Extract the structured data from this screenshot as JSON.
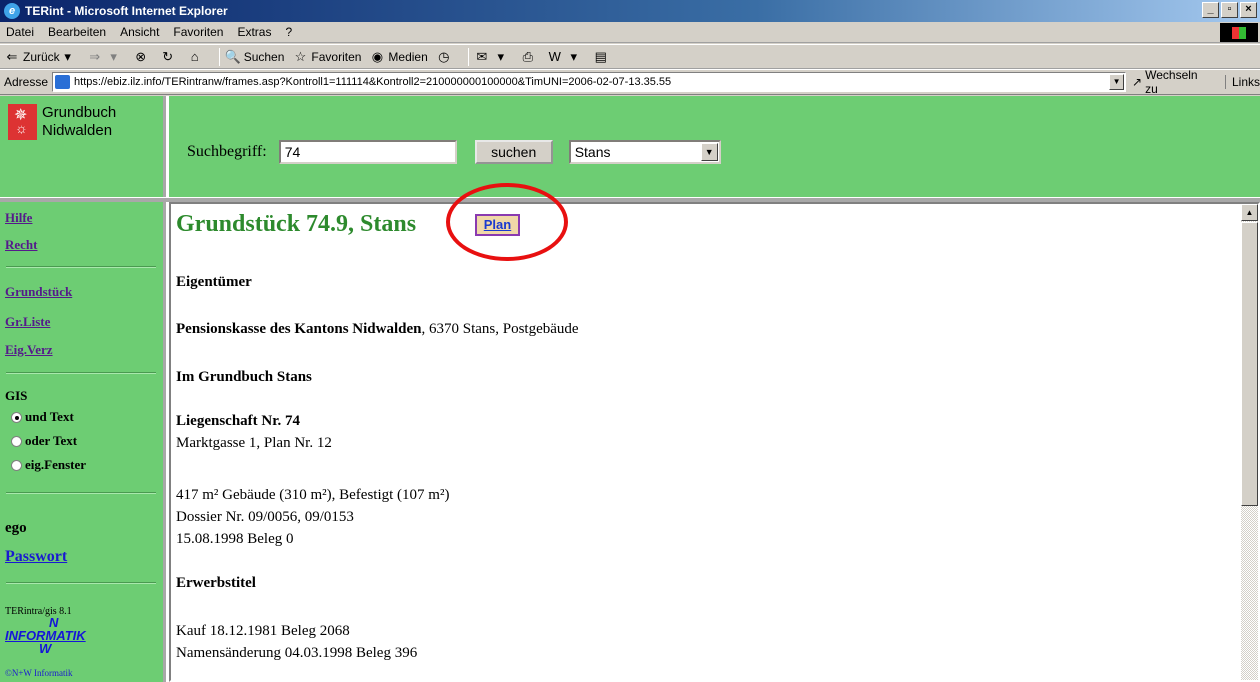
{
  "window": {
    "title": "TERint - Microsoft Internet Explorer",
    "minimize": "_",
    "maximize": "▫",
    "close": "×"
  },
  "menu": [
    "Datei",
    "Bearbeiten",
    "Ansicht",
    "Favoriten",
    "Extras",
    "?"
  ],
  "toolbar": {
    "back": "Zurück",
    "search": "Suchen",
    "favorites": "Favoriten",
    "media": "Medien"
  },
  "address": {
    "label": "Adresse",
    "url": "https://ebiz.ilz.info/TERintranw/frames.asp?Kontroll1=111114&Kontroll2=210000000100000&TimUNI=2006-02-07-13.35.55",
    "go": "Wechseln zu",
    "links": "Links"
  },
  "logo": {
    "line1": "Grundbuch",
    "line2": "Nidwalden"
  },
  "search": {
    "label": "Suchbegriff:",
    "value": "74",
    "button": "suchen",
    "municipality": "Stans"
  },
  "nav": {
    "help": "Hilfe",
    "law": "Recht",
    "parcel": "Grundstück",
    "parcel_list": "Gr.Liste",
    "owner_list": "Eig.Verz",
    "gis_label": "GIS",
    "gis_options": [
      {
        "label": "und Text",
        "checked": true
      },
      {
        "label": "oder Text",
        "checked": false
      },
      {
        "label": "eig.Fenster",
        "checked": false
      }
    ],
    "user": "ego",
    "password": "Passwort",
    "version": "TERintra/gis 8.1",
    "company_n": "N",
    "company": "INFORMATIK",
    "company_w": "W",
    "copyright": "©N+W Informatik"
  },
  "main": {
    "title": "Grundstück 74.9, Stans",
    "plan_button": "Plan",
    "owner_heading": "Eigentümer",
    "owner_name": "Pensionskasse des Kantons Nidwalden",
    "owner_address": ", 6370 Stans, Postgebäude",
    "registry_heading": "Im Grundbuch Stans",
    "property_heading": "Liegenschaft Nr. 74",
    "property_location": "Marktgasse 1, Plan Nr. 12",
    "area_line": "417 m² Gebäude (310 m²), Befestigt (107 m²)",
    "dossier_line": "Dossier Nr. 09/0056, 09/0153",
    "date_line": "15.08.1998 Beleg 0",
    "acquisition_heading": "Erwerbstitel",
    "acquisition_1": "Kauf 18.12.1981 Beleg 2068",
    "acquisition_2": "Namensänderung 04.03.1998 Beleg 396"
  }
}
